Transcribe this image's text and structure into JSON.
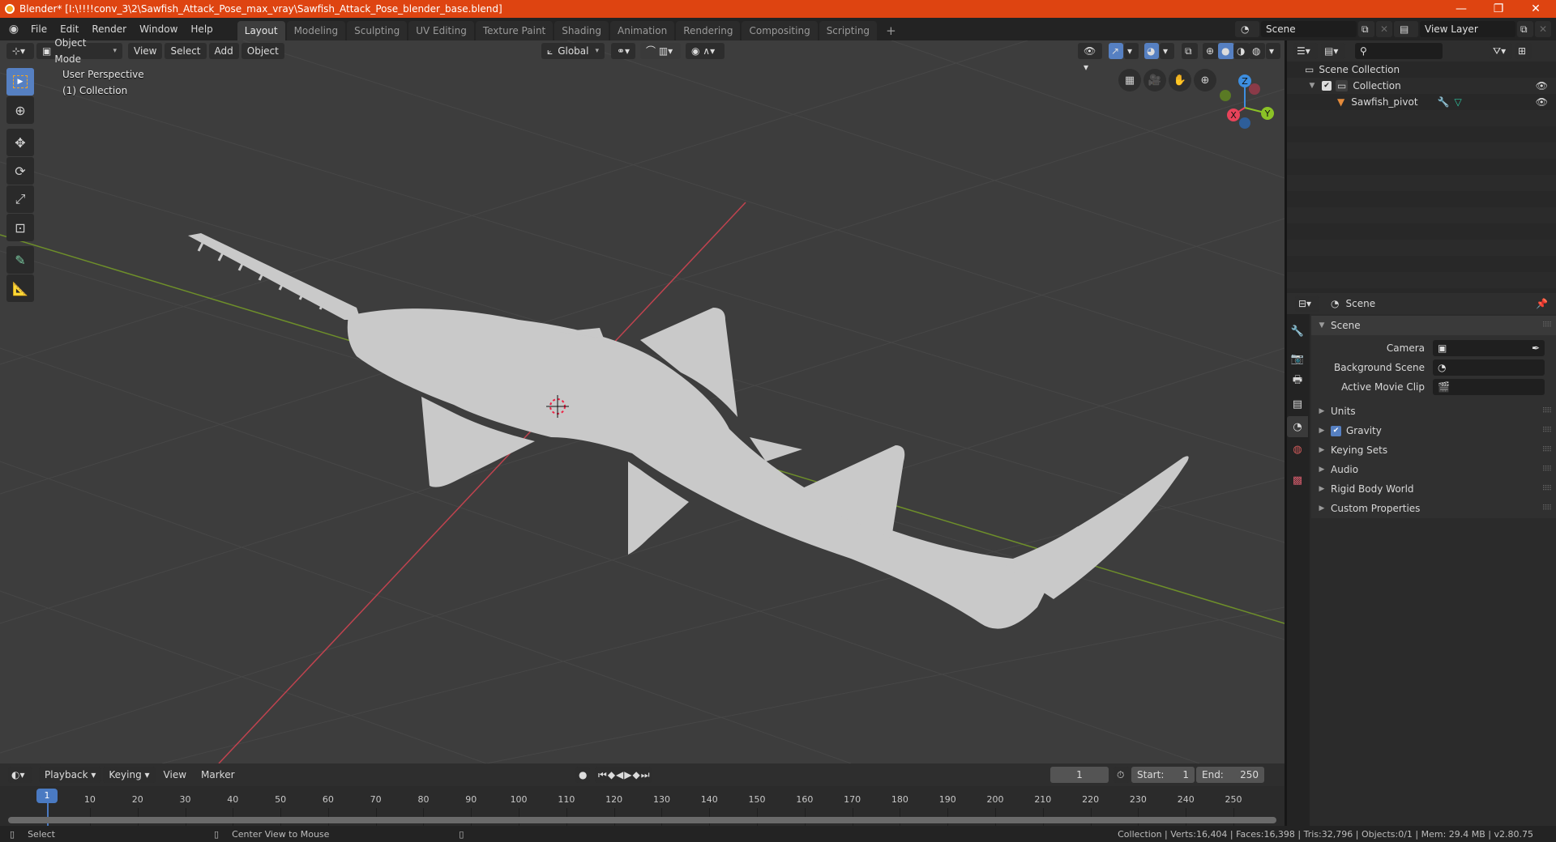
{
  "window": {
    "title": "Blender* [I:\\!!!!conv_3\\2\\Sawfish_Attack_Pose_max_vray\\Sawfish_Attack_Pose_blender_base.blend]",
    "controls": {
      "minimize": "—",
      "maximize": "❐",
      "close": "✕"
    }
  },
  "topbar": {
    "menus": [
      "File",
      "Edit",
      "Render",
      "Window",
      "Help"
    ],
    "workspaces": [
      "Layout",
      "Modeling",
      "Sculpting",
      "UV Editing",
      "Texture Paint",
      "Shading",
      "Animation",
      "Rendering",
      "Compositing",
      "Scripting"
    ],
    "active_workspace": "Layout",
    "add_workspace": "+",
    "scene": "Scene",
    "view_layer": "View Layer"
  },
  "viewport": {
    "mode": "Object Mode",
    "menus": [
      "View",
      "Select",
      "Add",
      "Object"
    ],
    "orientation": "Global",
    "info_line1": "User Perspective",
    "info_line2": "(1) Collection",
    "gizmo_axes": {
      "x": "X",
      "y": "Y",
      "z": "Z"
    },
    "colors": {
      "x_axis": "#e8435a",
      "y_axis": "#8bc226",
      "z_axis": "#3d8ee0",
      "active_tool": "#5680c2",
      "model": "#c9c9c9"
    },
    "tools": [
      "select-box",
      "cursor",
      "move",
      "rotate",
      "scale",
      "transform",
      "annotate",
      "measure"
    ],
    "nav_buttons": [
      "grid-view",
      "camera-view",
      "pan",
      "zoom"
    ]
  },
  "outliner": {
    "root": "Scene Collection",
    "items": [
      {
        "label": "Collection",
        "visible": true,
        "checked": true
      },
      {
        "label": "Sawfish_pivot",
        "visible": true
      }
    ]
  },
  "properties": {
    "context": "Scene",
    "panel_title": "Scene",
    "fields": [
      {
        "label": "Camera",
        "value": ""
      },
      {
        "label": "Background Scene",
        "value": ""
      },
      {
        "label": "Active Movie Clip",
        "value": ""
      }
    ],
    "subpanels": [
      {
        "label": "Units"
      },
      {
        "label": "Gravity",
        "checkbox": true
      },
      {
        "label": "Keying Sets"
      },
      {
        "label": "Audio"
      },
      {
        "label": "Rigid Body World"
      },
      {
        "label": "Custom Properties"
      }
    ]
  },
  "timeline": {
    "menus": [
      "Playback",
      "Keying",
      "View",
      "Marker"
    ],
    "current_frame": "1",
    "start_label": "Start:",
    "start": "1",
    "end_label": "End:",
    "end": "250",
    "ticks": [
      "10",
      "20",
      "30",
      "40",
      "50",
      "60",
      "70",
      "80",
      "90",
      "100",
      "110",
      "120",
      "130",
      "140",
      "150",
      "160",
      "170",
      "180",
      "190",
      "200",
      "210",
      "220",
      "230",
      "240",
      "250"
    ],
    "playhead": "1"
  },
  "statusbar": {
    "left_action": "Select",
    "middle_action": "Center View to Mouse",
    "stats": "Collection | Verts:16,404 | Faces:16,398 | Tris:32,796 | Objects:0/1 | Mem: 29.4 MB | v2.80.75"
  }
}
